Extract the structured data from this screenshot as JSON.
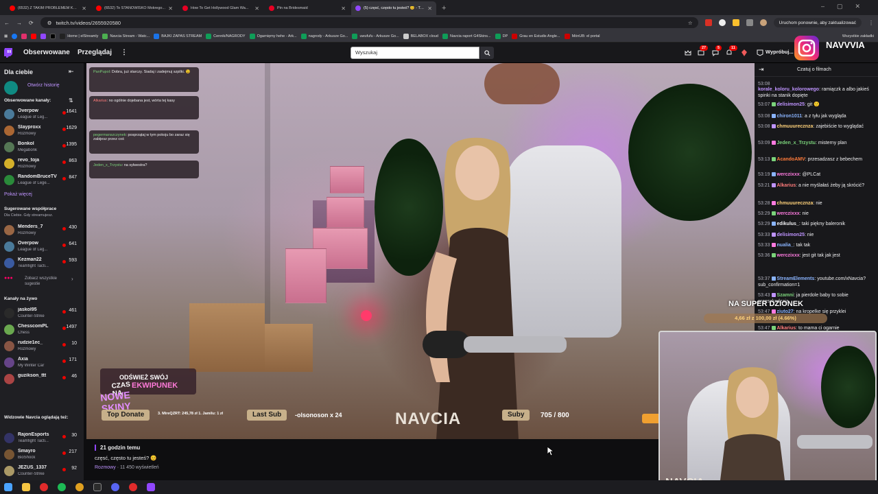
{
  "browser": {
    "tabs": [
      {
        "title": "(6532) Z TAKIM PROBLEMEM KOY...",
        "color": "#ff0000",
        "active": false
      },
      {
        "title": "(6532) To STANOWISKO Mokrego...",
        "color": "#ff0000",
        "active": false
      },
      {
        "title": "How To Get Hollywood Glam Wa...",
        "color": "#e60023",
        "active": false
      },
      {
        "title": "Pin na Bridesmaid",
        "color": "#e60023",
        "active": false
      },
      {
        "title": "(5) częsć, często tu jesteś? 😊 - Tw...",
        "color": "#9147ff",
        "active": true
      }
    ],
    "url": "twitch.tv/videos/2655920580",
    "update_button": "Uruchom ponownie, aby zaktualizować",
    "bookmarks": [
      {
        "label": "Home | elStreamly",
        "color": "#222"
      },
      {
        "label": "Navcia Stream - Watc...",
        "color": "#4caf50"
      },
      {
        "label": "BAJKI ZAPAS STREAM",
        "color": "#1a73e8"
      },
      {
        "label": "Cennik/NAGRODY",
        "color": "#0f9d58"
      },
      {
        "label": "Ogarnięmy hehe - Ark...",
        "color": "#0f9d58"
      },
      {
        "label": "nagrody - Arkusze Go...",
        "color": "#0f9d58"
      },
      {
        "label": "uwufufu - Arkusze Go...",
        "color": "#0f9d58"
      },
      {
        "label": "BELABOX cloud",
        "color": "#ccc"
      },
      {
        "label": "Navcia raport G4Skins...",
        "color": "#0f9d58"
      },
      {
        "label": "DP",
        "color": "#0f9d58"
      },
      {
        "label": "Grau en Estudis Angle...",
        "color": "#c00"
      },
      {
        "label": "MónUB: el portal",
        "color": "#c00"
      }
    ],
    "all_bookmarks": "Wszystkie zakładki"
  },
  "topnav": {
    "following": "Obserwowane",
    "browse": "Przeglądaj",
    "search_placeholder": "Wyszukaj",
    "badge1": "27",
    "badge2": "5",
    "badge3": "11",
    "adfree": "Wypróbuj..."
  },
  "overlay_social": {
    "handle": "NAVVVIA"
  },
  "sidebar": {
    "for_you": "Dla ciebie",
    "history": "Otwórz historię",
    "followed_title": "Obserwowane kanały:",
    "followed": [
      {
        "name": "Overpow",
        "game": "League of Leg...",
        "viewers": "1641",
        "color": "#4a7a9a"
      },
      {
        "name": "Slayproxx",
        "game": "Rozmowy",
        "viewers": "1629",
        "color": "#aa6633"
      },
      {
        "name": "Bonkol",
        "game": "Megabonk",
        "viewers": "1395",
        "color": "#557755"
      },
      {
        "name": "revo_toja",
        "game": "Rozmowy",
        "viewers": "863",
        "color": "#d4b02a"
      },
      {
        "name": "RandomBruceTV",
        "game": "League of Lege...",
        "viewers": "847",
        "color": "#2a8a3a"
      }
    ],
    "show_more": "Pokaż więcej",
    "suggested_title": "Sugerowane współprace",
    "suggested_sub": "Dla Ciebie. Gdy streamujesz.",
    "suggested": [
      {
        "name": "Menders_7",
        "game": "Rozmowy",
        "viewers": "430",
        "color": "#996644"
      },
      {
        "name": "Overpow",
        "game": "League of Leg...",
        "viewers": "641",
        "color": "#4a7a9a"
      },
      {
        "name": "Kezman22",
        "game": "Teamfight Tacti...",
        "viewers": "593",
        "color": "#3a5aa0"
      }
    ],
    "see_all": "Zobacz wszystkie sugestie",
    "live_title": "Kanały na żywo",
    "live": [
      {
        "name": "jaskol95",
        "game": "Counter-Strike",
        "viewers": "461",
        "color": "#2a2a2a"
      },
      {
        "name": "ChesscomPL",
        "game": "Chess",
        "viewers": "1497",
        "color": "#6aa84f"
      },
      {
        "name": "rudzie1ec_",
        "game": "Rozmowy",
        "viewers": "10",
        "color": "#885544"
      },
      {
        "name": "Axia",
        "game": "My Winter Car",
        "viewers": "171",
        "color": "#664488"
      },
      {
        "name": "guzikson_ttt",
        "game": "",
        "viewers": "46",
        "color": "#aa4444"
      }
    ],
    "also_watch_title": "Widzowie Navcia oglądają też:",
    "also_watch": [
      {
        "name": "RajonEsports",
        "game": "Teamfight Tacti...",
        "viewers": "30",
        "color": "#333366"
      },
      {
        "name": "Smayro",
        "game": "BioShock",
        "viewers": "217",
        "color": "#775533"
      },
      {
        "name": "JEZUS_1337",
        "game": "Counter-Strike",
        "viewers": "92",
        "color": "#aa9966"
      }
    ]
  },
  "stream_overlay": {
    "chat_overlay": [
      {
        "user": "PanPupol",
        "text": "Dobra, już starczy. Siadaj i zadejmuj szpilki. 😉"
      },
      {
        "user": "Alkarius",
        "text": "no ogólnie dojebana jest, wórta tej kasy"
      },
      {
        "user": "pegermanszczynek",
        "text": "posprzątaj w tym pokoju bo zaraz się zabijesz przez coś"
      },
      {
        "user": "Jeden_x_Trzystu",
        "text": "na sylwestra?"
      }
    ],
    "refresh_title": "ODŚWIEŻ SWÓJ",
    "refresh_sub": "EKWIPUNEK",
    "skins_top": "CZAS NA",
    "skins_bottom": "NOWE SKINY",
    "top_donate_label": "Top Donate",
    "top_donate_text": "3. MireQZRT: 245,78 zł  1. Jamilu: 1 zł",
    "last_sub_label": "Last Sub",
    "last_sub_text": "-olsonoson x 24",
    "logo": "NAVCIA",
    "subs_label": "Suby",
    "subs_value": "705 / 800",
    "goal_title": "NA SUPER DZIONEK",
    "goal_value": "4,66 zł z 100,00 zł",
    "goal_pct": "(4.66%)",
    "pip_name": "NAVCIA"
  },
  "video_info": {
    "time_ago": "21 godzin temu",
    "title": "częsć, często tu jesteś? 😊",
    "category": "Rozmowy",
    "views": "· 11 450 wyświetleń"
  },
  "chat": {
    "header": "Czatuj o filmach",
    "messages": [
      {
        "ts": "53:08",
        "user": "",
        "text": "",
        "color": "#efeff1"
      },
      {
        "ts": "",
        "user": "korale_koloru_kolorowego",
        "text": ": ramiączk a albo jakieś spinki na stanik dopięte",
        "color": "#bf94ff"
      },
      {
        "ts": "53:07",
        "user": "delisimon25",
        "text": ": git 🙂",
        "color": "#bf94ff"
      },
      {
        "ts": "53:08",
        "user": "chiron1011",
        "text": ": a z tyłu jak wygląda",
        "color": "#8ab4ff"
      },
      {
        "ts": "53:08",
        "user": "chmuuurecznza",
        "text": ": zajebiście to wyglądać",
        "color": "#ffd27a"
      },
      {
        "ts": "53:09",
        "user": "Jeden_x_Trzystu",
        "text": ": misterny plan",
        "color": "#7bd37b"
      },
      {
        "ts": "53:13",
        "user": "AcandoAMV",
        "text": ": przesadzasz z bebechem",
        "color": "#ff7b3a"
      },
      {
        "ts": "53:19",
        "user": "werczixxx",
        "text": ": @PLCat",
        "color": "#ff7be0"
      },
      {
        "ts": "53:21",
        "user": "Alkarius",
        "text": ": a nie myślałaś żeby ją skrócić?",
        "color": "#ff7b7b"
      },
      {
        "ts": "53:28",
        "user": "chmuuurecznza",
        "text": ": nie",
        "color": "#ffd27a"
      },
      {
        "ts": "53:29",
        "user": "werczixxx",
        "text": ": nie",
        "color": "#ff7be0"
      },
      {
        "ts": "53:29",
        "user": "edikulus_",
        "text": ": taki piękny baleronik",
        "color": "#efeff1"
      },
      {
        "ts": "53:33",
        "user": "delisimon25",
        "text": ": nie",
        "color": "#bf94ff"
      },
      {
        "ts": "53:33",
        "user": "nualia_",
        "text": ": tak tak",
        "color": "#8ab4ff"
      },
      {
        "ts": "53:36",
        "user": "werczixxx",
        "text": ": jest git tak jak jest",
        "color": "#ff7be0"
      },
      {
        "ts": "53:37",
        "user": "StreamElements",
        "text": ": youtube.com/xNavcia?sub_confirmation=1",
        "color": "#8ab4ff"
      },
      {
        "ts": "53:43",
        "user": "Szamni",
        "text": ": ja pierdole baby to sobie przeszkadzają",
        "color": "#7bd37b"
      },
      {
        "ts": "53:47",
        "user": "ziuto27",
        "text": ": na kropelke się przyklei",
        "color": "#8ab4ff"
      },
      {
        "ts": "53:47",
        "user": "Alkarius",
        "text": ": to mama ci ogarnie",
        "color": "#ff7b7b"
      }
    ]
  }
}
